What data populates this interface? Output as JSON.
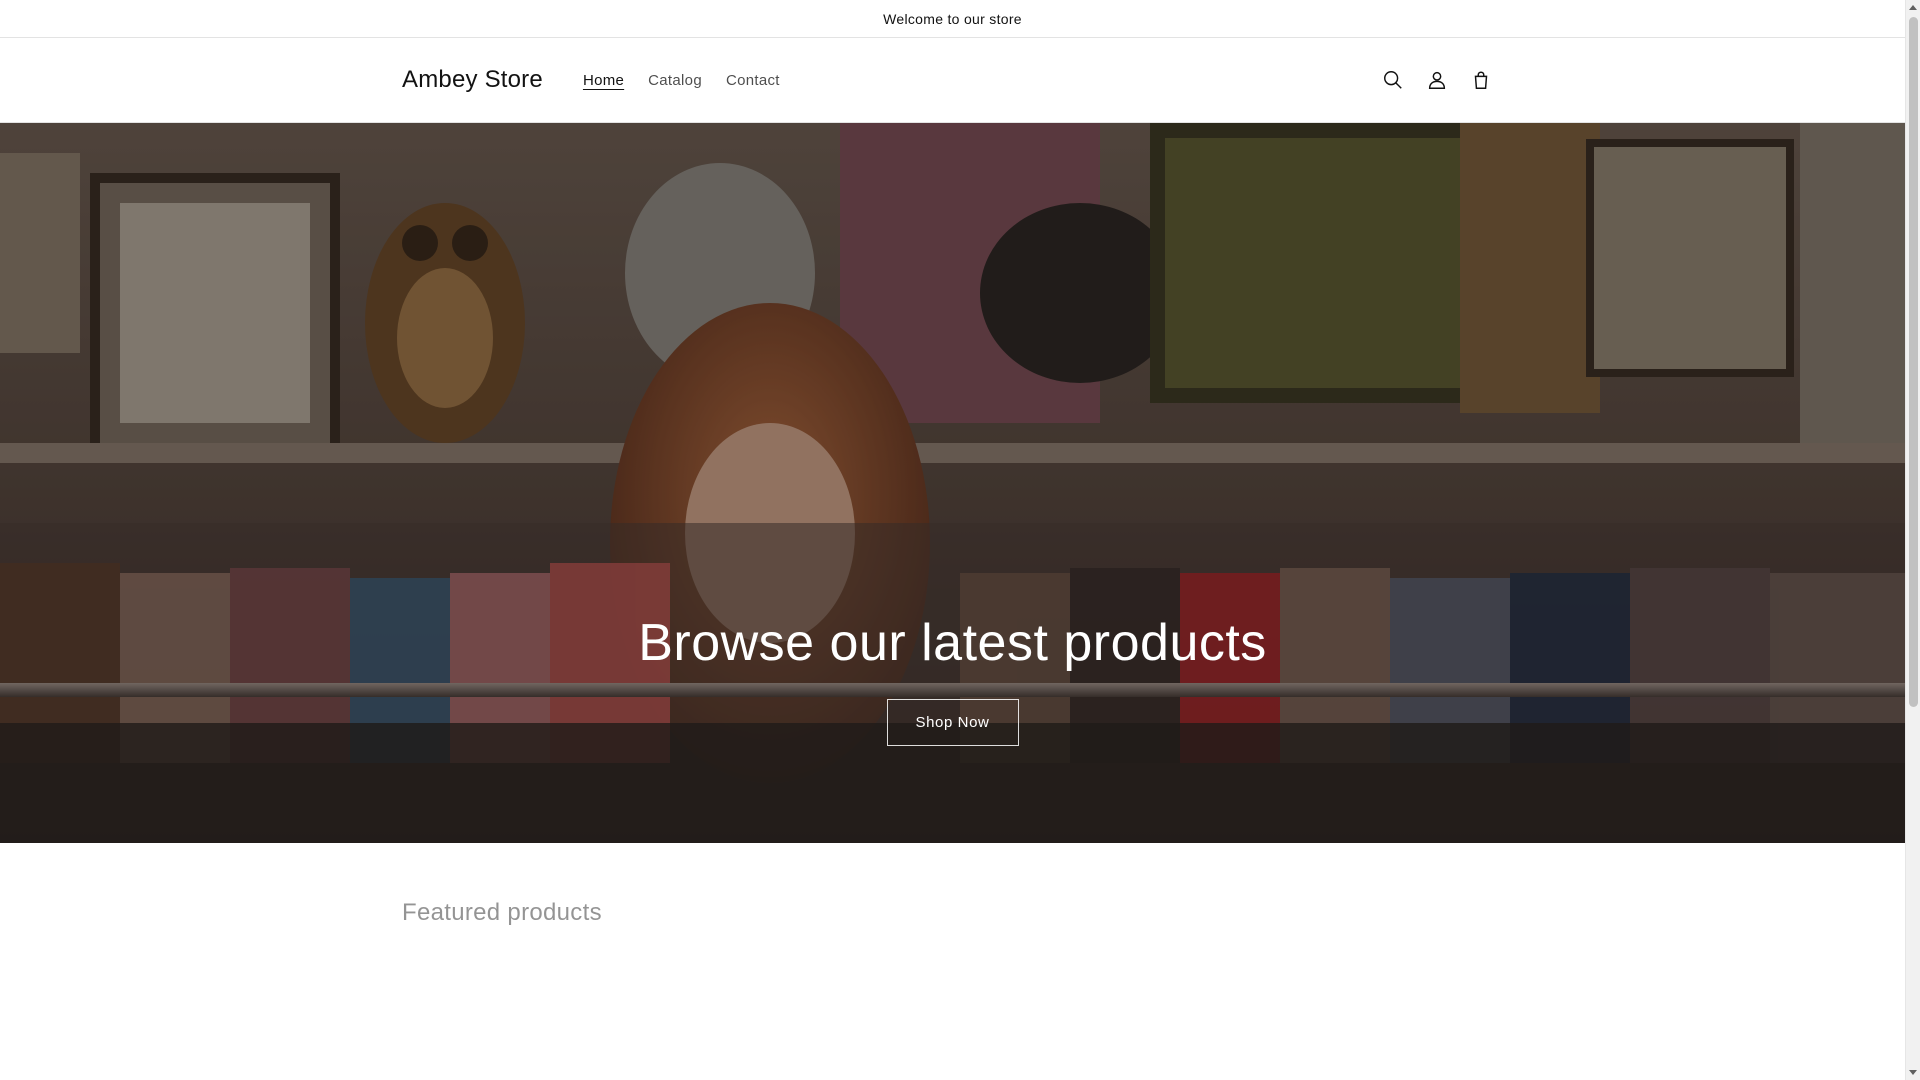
{
  "announcement": {
    "text": "Welcome to our store"
  },
  "header": {
    "logo": "Ambey Store",
    "nav": [
      {
        "label": "Home",
        "active": true
      },
      {
        "label": "Catalog",
        "active": false
      },
      {
        "label": "Contact",
        "active": false
      }
    ],
    "icons": [
      "search-icon",
      "account-icon",
      "cart-icon"
    ]
  },
  "hero": {
    "title": "Browse our latest products",
    "button_label": "Shop Now"
  },
  "featured": {
    "title": "Featured products"
  },
  "colors": {
    "text": "#121212",
    "border": "#e3e3e3",
    "hero_overlay": "#000000"
  }
}
